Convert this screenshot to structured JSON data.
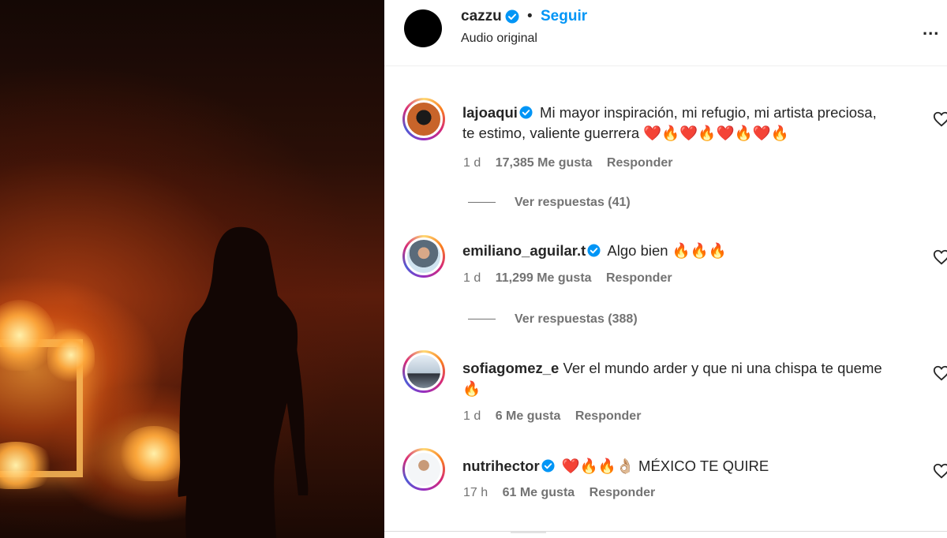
{
  "post": {
    "username": "cazzu",
    "separator": "•",
    "follow_label": "Seguir",
    "audio_label": "Audio original",
    "more_label": "..."
  },
  "media": {
    "icon": "silhouette-fire-image"
  },
  "comments": [
    {
      "username": "lajoaqui",
      "verified": true,
      "text": "Mi mayor inspiración, mi refugio, mi artista preciosa, te estimo, valiente guerrera ❤️🔥❤️🔥❤️🔥❤️🔥",
      "time": "1 d",
      "likes": "17,385 Me gusta",
      "reply_label": "Responder",
      "view_replies": "Ver respuestas (41)"
    },
    {
      "username": "emiliano_aguilar.t",
      "verified": true,
      "text": "Algo bien 🔥🔥🔥",
      "time": "1 d",
      "likes": "11,299 Me gusta",
      "reply_label": "Responder",
      "view_replies": "Ver respuestas (388)"
    },
    {
      "username": "sofiagomez_e",
      "verified": false,
      "text": "Ver el mundo arder y que ni una chispa te queme 🔥",
      "time": "1 d",
      "likes": "6 Me gusta",
      "reply_label": "Responder"
    },
    {
      "username": "nutrihector",
      "verified": true,
      "text": "❤️🔥🔥👌🏼 MÉXICO TE QUIRE",
      "time": "17 h",
      "likes": "61 Me gusta",
      "reply_label": "Responder"
    }
  ],
  "colors": {
    "link_blue": "#0095f6",
    "verified_blue": "#0095f6",
    "secondary_text": "#737373"
  }
}
